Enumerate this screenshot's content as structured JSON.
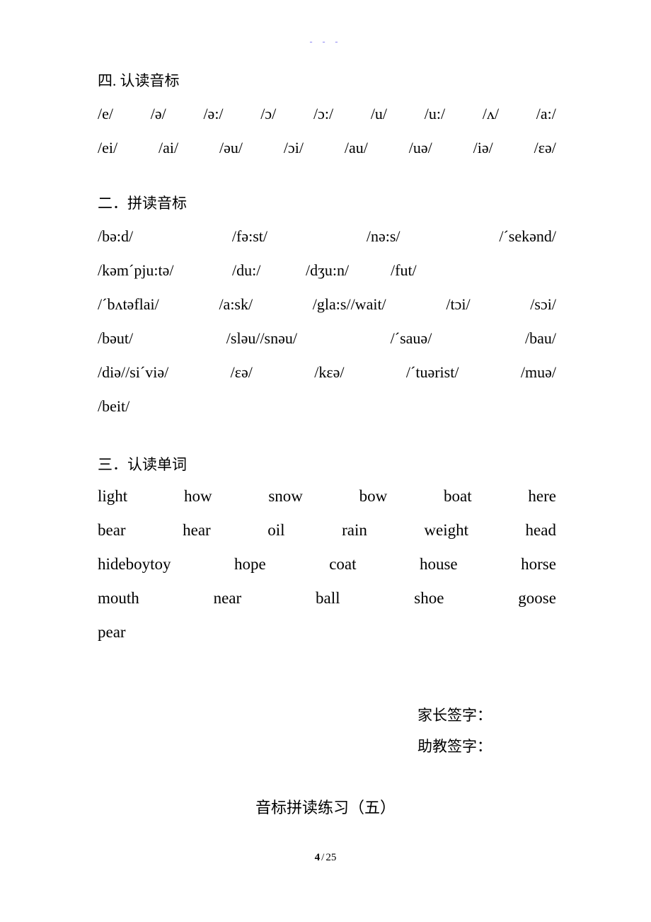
{
  "header_mark": "- - -",
  "sections": [
    {
      "heading": "四. 认读音标",
      "rows": [
        [
          "/e/",
          "/ə/",
          "/ə:/",
          "/ɔ/",
          "/ɔ:/",
          "/u/",
          "/u:/",
          "/ʌ/",
          "/a:/"
        ],
        [
          "/ei/",
          "/ai/",
          "/əu/",
          "/ɔi/",
          "/au/",
          "/uə/",
          "/iə/",
          "/ɛə/"
        ]
      ]
    },
    {
      "heading": "二．拼读音标",
      "rows": [
        [
          "/bə:d/",
          "/fə:st/",
          "/nə:s/",
          "/´sekənd/"
        ],
        [
          "/kəm´pju:tə/",
          "/du:/",
          "/dʒu:n/",
          "/fut/"
        ],
        [
          "/´bʌtəflai/",
          "/a:sk/",
          "/gla:s//wait/",
          "/tɔi/",
          "/sɔi/"
        ],
        [
          "/bəut/",
          "/sləu//snəu/",
          "/´sauə/",
          "/bau/"
        ],
        [
          "/diə//si´viə/",
          "/ɛə/",
          "/kɛə/",
          "/´tuərist/",
          "/muə/"
        ],
        [
          "/beit/"
        ]
      ]
    },
    {
      "heading": "三．认读单词",
      "rows": [
        [
          "light",
          "how",
          "snow",
          "bow",
          "boat",
          "here"
        ],
        [
          "bear",
          "hear",
          "oil",
          "rain",
          "weight",
          "head"
        ],
        [
          "hideboytoy",
          "hope",
          "coat",
          "house",
          "horse"
        ],
        [
          "mouth",
          "near",
          "ball",
          "shoe",
          "goose"
        ],
        [
          "pear"
        ]
      ]
    }
  ],
  "signatures": [
    "家长签字：",
    "助教签字："
  ],
  "bottom_title": "音标拼读练习（五）",
  "footer": {
    "current_page": "4",
    "separator": "/",
    "total_pages": "25"
  }
}
